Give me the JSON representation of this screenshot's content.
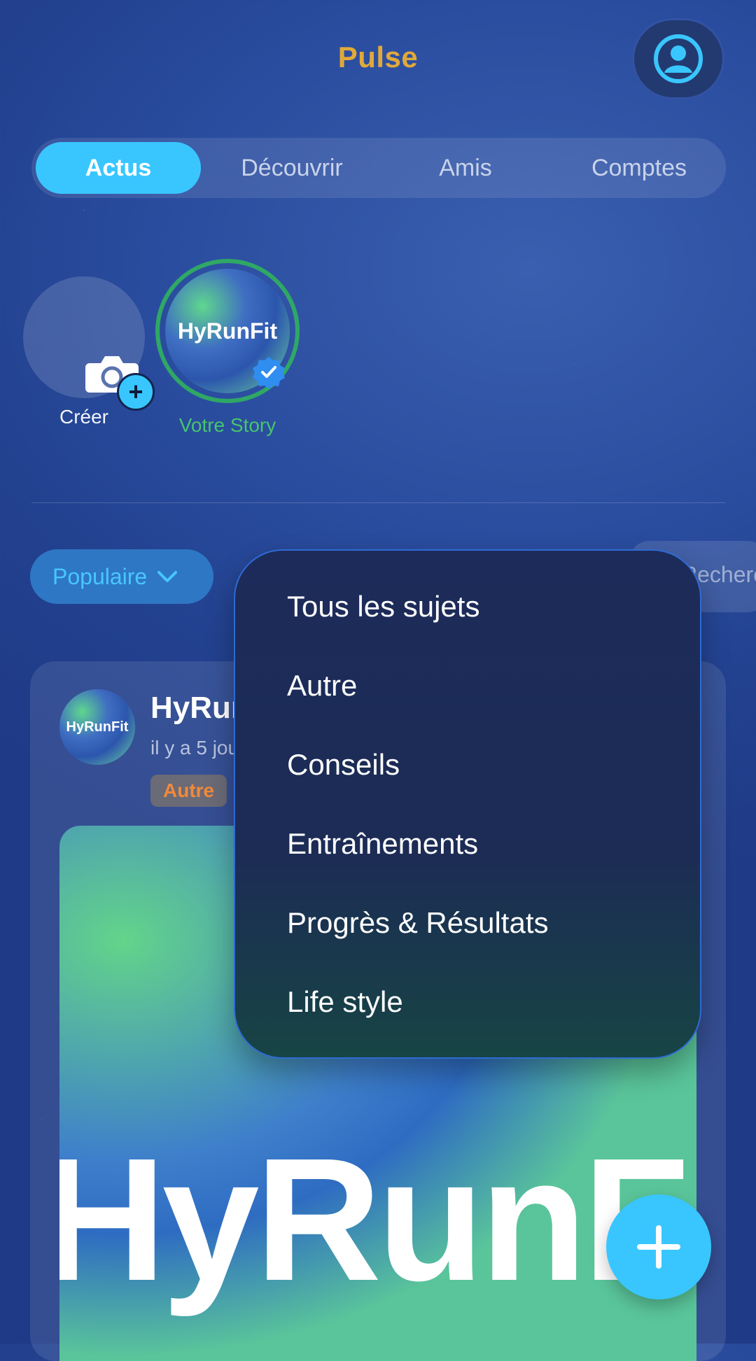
{
  "app": {
    "title": "Pulse"
  },
  "tabs": [
    {
      "label": "Actus",
      "active": true
    },
    {
      "label": "Découvrir",
      "active": false
    },
    {
      "label": "Amis",
      "active": false
    },
    {
      "label": "Comptes",
      "active": false
    }
  ],
  "stories": {
    "create_label": "Créer",
    "own": {
      "avatar_text": "HyRunFit",
      "label": "Votre Story",
      "verified": true
    }
  },
  "filters": {
    "sort_label": "Populaire",
    "search_placeholder": "Rechercher"
  },
  "dropdown": {
    "items": [
      "Tous les sujets",
      "Autre",
      "Conseils",
      "Entraînements",
      "Progrès & Résultats",
      "Life style"
    ]
  },
  "post": {
    "avatar_text": "HyRunFit",
    "username": "HyRunFit",
    "time": "il y a 5 jours",
    "tag": "Autre",
    "image_text": "HyRunFit"
  },
  "colors": {
    "accent": "#39c6ff",
    "title": "#e0a93a",
    "story_ring": "#2fa866",
    "tag_text": "#f08a3c"
  },
  "icons": [
    "profile-icon",
    "camera-icon",
    "plus-icon",
    "verified-icon",
    "chevron-down-icon",
    "add-icon"
  ]
}
